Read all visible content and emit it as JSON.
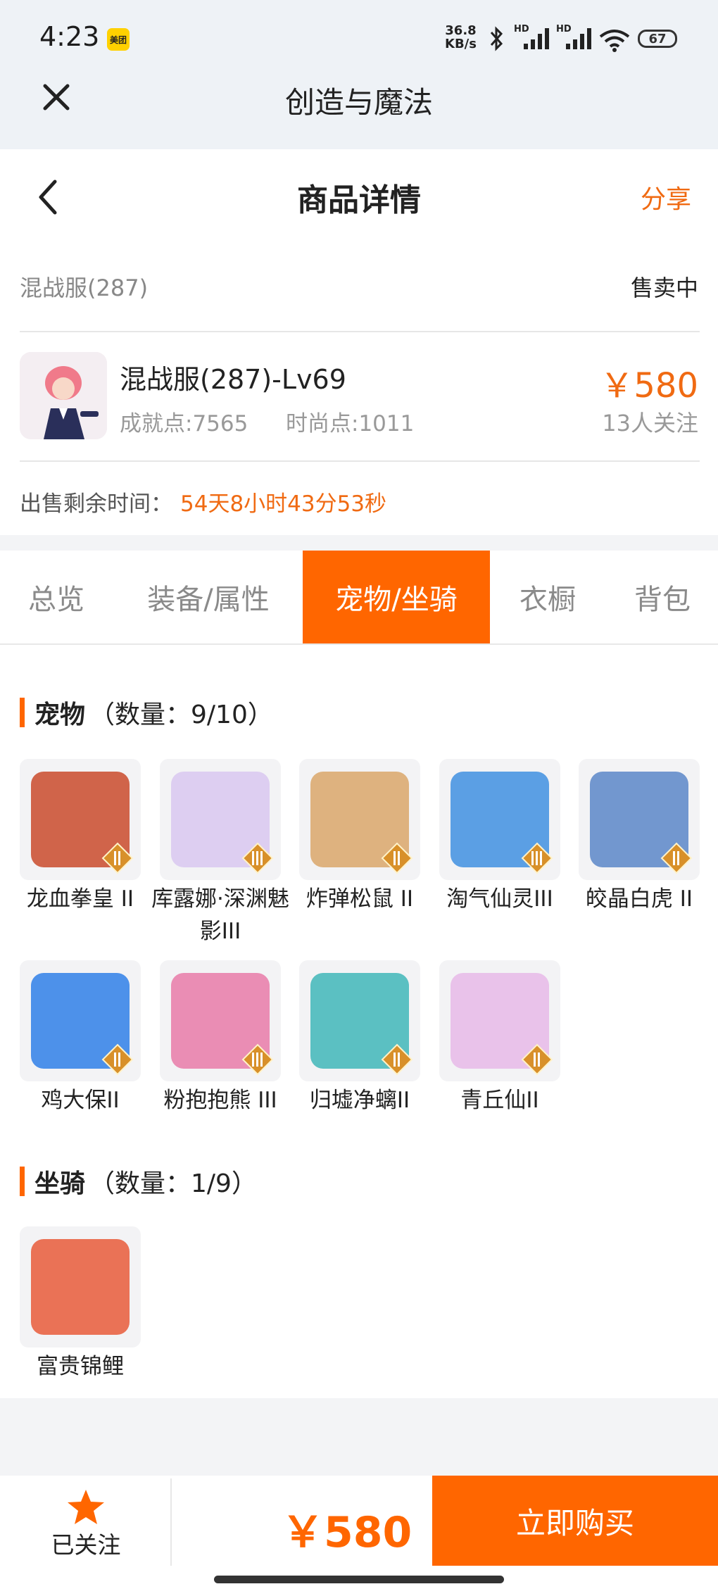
{
  "status_bar": {
    "time": "4:23",
    "app_badge": "美团",
    "net_speed_value": "36.8",
    "net_speed_unit": "KB/s",
    "signal1_label": "HD",
    "signal2_label": "HD",
    "battery": "67"
  },
  "header": {
    "app_title": "创造与魔法",
    "page_title": "商品详情",
    "share_label": "分享"
  },
  "listing": {
    "server": "混战服(287)",
    "status": "售卖中",
    "title": "混战服(287)-Lv69",
    "achievement": "成就点:7565",
    "fashion": "时尚点:1011",
    "price": "￥580",
    "followers": "13人关注",
    "remaining_label": "出售剩余时间：",
    "remaining_value": "54天8小时43分53秒"
  },
  "tabs": [
    {
      "label": "总览",
      "active": false
    },
    {
      "label": "装备/属性",
      "active": false
    },
    {
      "label": "宠物/坐骑",
      "active": true
    },
    {
      "label": "衣橱",
      "active": false
    },
    {
      "label": "背包",
      "active": false
    }
  ],
  "pets_section": {
    "title": "宠物",
    "count": "（数量：9/10）",
    "items": [
      {
        "name": "龙血拳皇 II",
        "badge": "II",
        "color": "#c94a2c"
      },
      {
        "name": "库露娜·深渊魅影III",
        "badge": "III",
        "color": "#d8c7f0"
      },
      {
        "name": "炸弹松鼠 II",
        "badge": "II",
        "color": "#d9a66a"
      },
      {
        "name": "淘气仙灵III",
        "badge": "III",
        "color": "#3f8fe0"
      },
      {
        "name": "皎晶白虎 II",
        "badge": "II",
        "color": "#5a86c8"
      },
      {
        "name": "鸡大保II",
        "badge": "II",
        "color": "#2f7fe8"
      },
      {
        "name": "粉抱抱熊 III",
        "badge": "III",
        "color": "#e87aa8"
      },
      {
        "name": "归墟净螭II",
        "badge": "II",
        "color": "#3fb6b8"
      },
      {
        "name": "青丘仙II",
        "badge": "II",
        "color": "#e6b8e8"
      }
    ]
  },
  "mounts_section": {
    "title": "坐骑",
    "count": "（数量：1/9）",
    "items": [
      {
        "name": "富贵锦鲤",
        "color": "#e85a3a"
      }
    ]
  },
  "bottom_bar": {
    "follow_label": "已关注",
    "price": "￥580",
    "buy_label": "立即购买"
  },
  "colors": {
    "accent": "#ff6600",
    "price": "#f06a12"
  }
}
